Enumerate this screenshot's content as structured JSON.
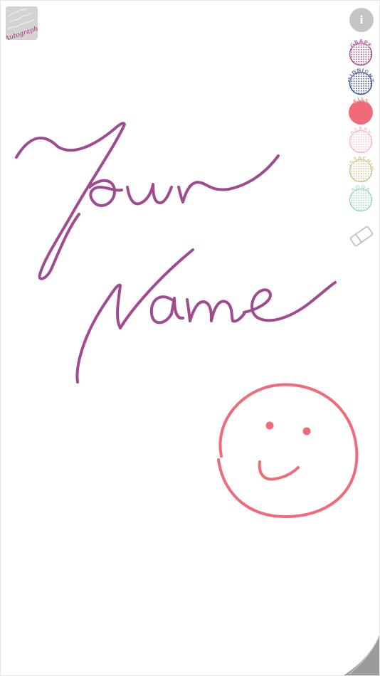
{
  "logo": {
    "text": "Autograph",
    "accent": "#b0307a"
  },
  "info_button": {
    "label": "i",
    "color": "#c4c4c4"
  },
  "palette": [
    {
      "name": "GRAPE",
      "color": "#a04a8f"
    },
    {
      "name": "MIDNIGHT",
      "color": "#3c4a8c"
    },
    {
      "name": "KISS",
      "color": "#f06a78"
    },
    {
      "name": "BERRY",
      "color": "#f7b7cf"
    },
    {
      "name": "PISTACHIO",
      "color": "#c8c28a"
    },
    {
      "name": "SODA",
      "color": "#9fd3c2"
    }
  ],
  "selected_color": "KISS",
  "tools": {
    "eraser": "eraser-icon"
  },
  "drawing": {
    "strokes": [
      {
        "ink": "GRAPE",
        "content": "Your"
      },
      {
        "ink": "GRAPE",
        "content": "Name"
      },
      {
        "ink": "KISS",
        "content": "smiley face"
      }
    ]
  }
}
